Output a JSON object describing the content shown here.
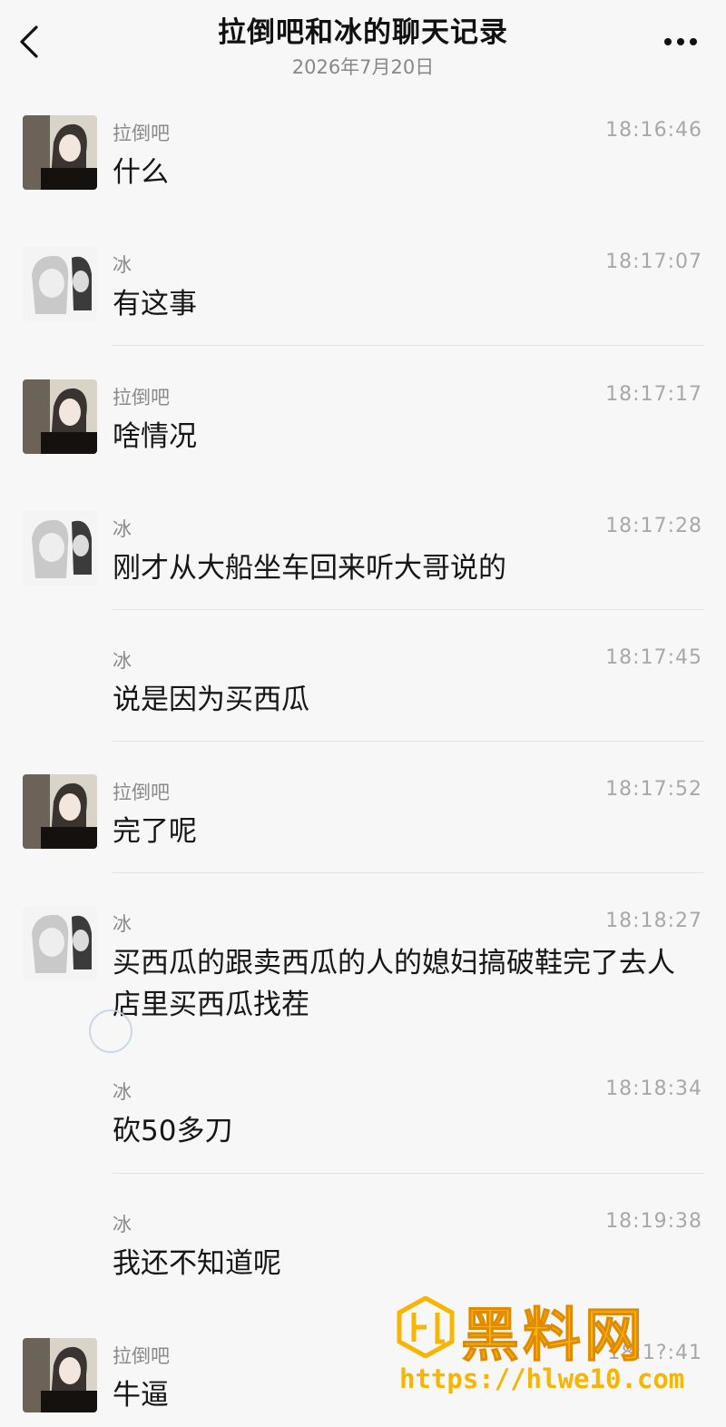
{
  "header": {
    "title": "拉倒吧和冰的聊天记录",
    "date": "2026年7月20日",
    "back_icon": "chevron-left-icon",
    "more_icon": "ellipsis-icon"
  },
  "messages": [
    {
      "sender": "拉倒吧",
      "time": "18:16:46",
      "text": "什么"
    },
    {
      "sender": "冰",
      "time": "18:17:07",
      "text": "有这事"
    },
    {
      "sender": "拉倒吧",
      "time": "18:17:17",
      "text": "啥情况"
    },
    {
      "sender": "冰",
      "time": "18:17:28",
      "text": "刚才从大船坐车回来听大哥说的"
    },
    {
      "sender": "冰",
      "time": "18:17:45",
      "text": "说是因为买西瓜"
    },
    {
      "sender": "拉倒吧",
      "time": "18:17:52",
      "text": "完了呢"
    },
    {
      "sender": "冰",
      "time": "18:18:27",
      "text": "买西瓜的跟卖西瓜的人的媳妇搞破鞋完了去人店里买西瓜找茬"
    },
    {
      "sender": "冰",
      "time": "18:18:34",
      "text": "砍50多刀"
    },
    {
      "sender": "冰",
      "time": "18:19:38",
      "text": "我还不知道呢"
    },
    {
      "sender": "拉倒吧",
      "time": "18:1?:41",
      "text": "牛逼"
    }
  ],
  "watermark": {
    "title": "黑料网",
    "url": "https://hlwe10.com",
    "color": "#f7b400"
  },
  "colors": {
    "background": "#f7f7f7",
    "sender": "#8a8a8a",
    "time": "#a8a8a8",
    "divider": "#e3e3e3"
  }
}
